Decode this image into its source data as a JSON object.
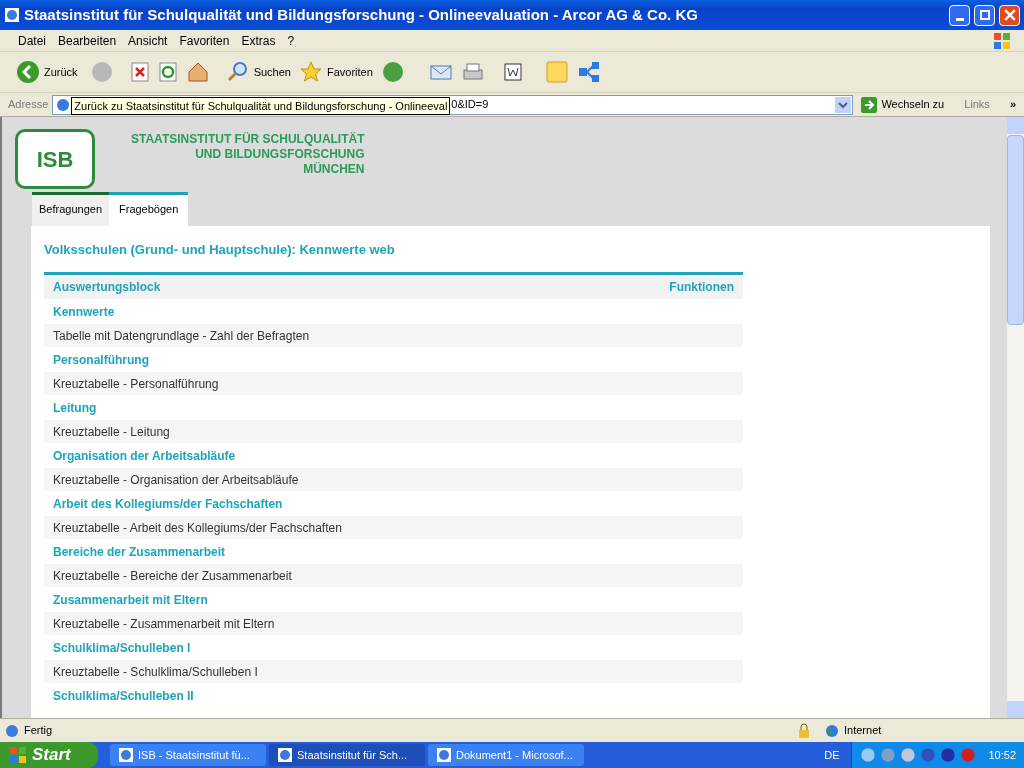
{
  "window": {
    "title": "Staatsinstitut für Schulqualität und Bildungsforschung - Onlineevaluation - Arcor AG & Co. KG"
  },
  "menu": [
    "Datei",
    "Bearbeiten",
    "Ansicht",
    "Favoriten",
    "Extras",
    "?"
  ],
  "toolbar": {
    "back": "Zurück",
    "search": "Suchen",
    "favorites": "Favoriten"
  },
  "address": {
    "label": "Adresse",
    "value": "0&ID=9",
    "tooltip": "Zurück zu Staatsinstitut für Schulqualität und Bildungsforschung - Onlineeval",
    "go": "Wechseln zu",
    "links": "Links",
    "more": "»"
  },
  "page": {
    "logo": "ISB",
    "institute": [
      "STAATSINSTITUT FÜR SCHULQUALITÄT",
      "UND BILDUNGSFORSCHUNG",
      "MÜNCHEN"
    ],
    "tabs": [
      {
        "label": "Befragungen",
        "selected": false
      },
      {
        "label": "Fragebögen",
        "selected": true
      }
    ],
    "heading": "Volksschulen (Grund- und Hauptschule): Kennwerte web",
    "table": {
      "columns": [
        "Auswertungsblock",
        "Funktionen"
      ],
      "rows": [
        {
          "kind": "section",
          "text": "Kennwerte"
        },
        {
          "kind": "item",
          "text": "Tabelle mit Datengrundlage - Zahl der Befragten"
        },
        {
          "kind": "section",
          "text": "Personalführung"
        },
        {
          "kind": "item",
          "text": "Kreuztabelle - Personalführung"
        },
        {
          "kind": "section",
          "text": "Leitung"
        },
        {
          "kind": "item",
          "text": "Kreuztabelle - Leitung"
        },
        {
          "kind": "section",
          "text": "Organisation der Arbeitsabläufe"
        },
        {
          "kind": "item",
          "text": "Kreuztabelle - Organisation der Arbeitsabläufe"
        },
        {
          "kind": "section",
          "text": "Arbeit des Kollegiums/der Fachschaften"
        },
        {
          "kind": "item",
          "text": "Kreuztabelle - Arbeit des Kollegiums/der Fachschaften"
        },
        {
          "kind": "section",
          "text": "Bereiche der Zusammenarbeit"
        },
        {
          "kind": "item",
          "text": "Kreuztabelle - Bereiche der Zusammenarbeit"
        },
        {
          "kind": "section",
          "text": "Zusammenarbeit mit Eltern"
        },
        {
          "kind": "item",
          "text": "Kreuztabelle - Zusammenarbeit mit Eltern"
        },
        {
          "kind": "section",
          "text": "Schulklima/Schulleben I"
        },
        {
          "kind": "item",
          "text": "Kreuztabelle - Schulklima/Schulleben I"
        },
        {
          "kind": "section",
          "text": "Schulklima/Schulleben II"
        }
      ]
    }
  },
  "status_bar": {
    "text": "Fertig",
    "zone": "Internet"
  },
  "taskbar": {
    "start": "Start",
    "tasks": [
      {
        "label": "ISB - Staatsinstitut fü...",
        "selected": false
      },
      {
        "label": "Staatsinstitut für Sch...",
        "selected": true
      },
      {
        "label": "Dokument1 - Microsof...",
        "selected": false
      }
    ],
    "language": "DE",
    "clock": "10:52"
  }
}
